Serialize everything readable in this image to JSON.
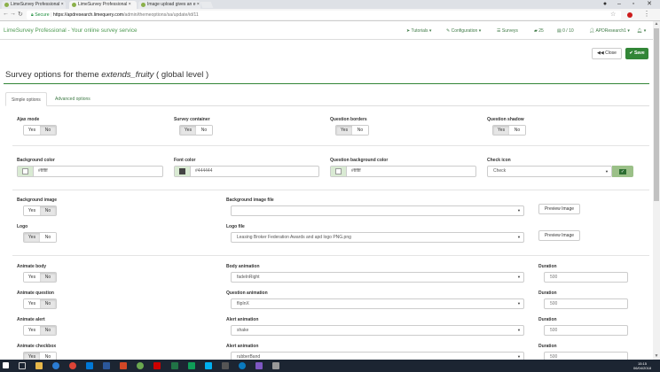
{
  "browser": {
    "tabs": [
      {
        "label": "LimeSurvey Professional ×"
      },
      {
        "label": "LimeSurvey Professional ×"
      },
      {
        "label": "Image upload gives an e ×"
      }
    ],
    "url_secure": "Secure",
    "url_host": "https://apdresearch.limequery.com",
    "url_path": "/admin/themeoptions/sa/update/id/11"
  },
  "navbar": {
    "brand": "LimeSurvey Professional - Your online survey service",
    "tutorials": "Tutorials",
    "configuration": "Configuration",
    "surveys": "Surveys",
    "responses": "25",
    "storage": "0 / 10",
    "user": "APDResearch1"
  },
  "toolbar": {
    "close": "Close",
    "save": "Save"
  },
  "page": {
    "title_prefix": "Survey options for theme ",
    "title_theme": "extends_fruity",
    "title_suffix": " ( global level )"
  },
  "subtabs": {
    "simple": "Simple options",
    "advanced": "Advanced options"
  },
  "toggle": {
    "yes": "Yes",
    "no": "No"
  },
  "form": {
    "ajax_mode": "Ajax mode",
    "survey_container": "Survey container",
    "question_borders": "Question borders",
    "question_shadow": "Question shadow",
    "background_color": "Background color",
    "background_color_value": "#ffffff",
    "font_color": "Font color",
    "font_color_value": "#444444",
    "question_bg_color": "Question background color",
    "question_bg_color_value": "#ffffff",
    "check_icon": "Check icon",
    "check_icon_value": "Check",
    "background_image": "Background image",
    "background_image_file": "Background image file",
    "background_image_file_value": "",
    "preview_image": "Preview Image",
    "logo": "Logo",
    "logo_file": "Logo file",
    "logo_file_value": "Leasing Broker Federation Awards and apd logo PNG.png",
    "animate_body": "Animate body",
    "body_animation": "Body animation",
    "body_animation_value": "fadeInRight",
    "duration": "Duration",
    "duration_value": "500",
    "animate_question": "Animate question",
    "question_animation": "Question animation",
    "question_animation_value": "flipInX",
    "animate_alert": "Animate alert",
    "alert_animation": "Alert animation",
    "alert_animation_value": "shake",
    "animate_checkbox": "Animate checkbox",
    "checkbox_animation_value": "rubberBand"
  },
  "taskbar": {
    "time": "15:15",
    "date": "06/04/2018"
  },
  "colors": {
    "accent": "#328637",
    "brand_text": "#4e9a52"
  }
}
